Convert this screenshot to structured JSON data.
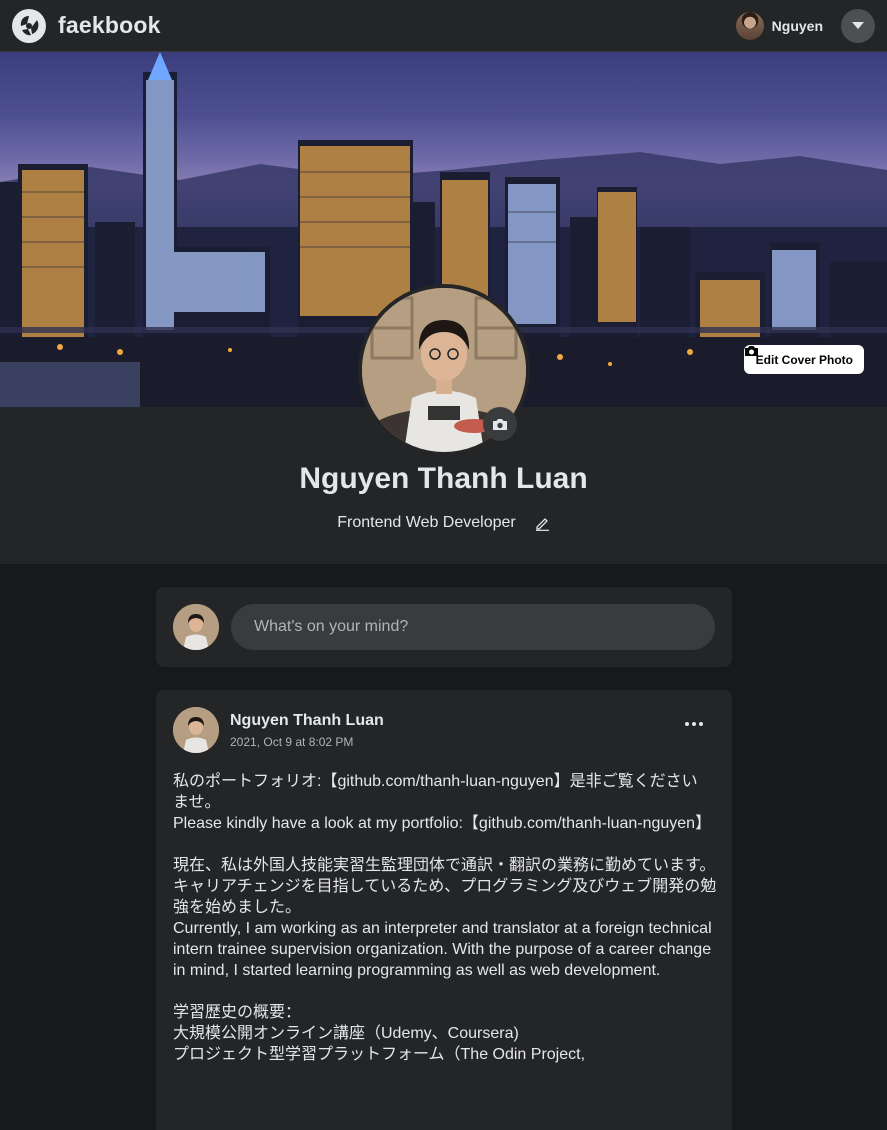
{
  "nav": {
    "brand": "faekbook",
    "user_name": "Nguyen"
  },
  "profile": {
    "name": "Nguyen Thanh Luan",
    "bio": "Frontend Web Developer",
    "edit_cover_label": "Edit Cover Photo"
  },
  "composer": {
    "placeholder": "What's on your mind?"
  },
  "post": {
    "author": "Nguyen Thanh Luan",
    "timestamp": "2021, Oct 9 at 8:02 PM",
    "paragraphs": [
      "私のポートフォリオ:【github.com/thanh-luan-nguyen】是非ご覧ください ませ。\nPlease kindly have a look at my portfolio:【github.com/thanh-luan-nguyen】",
      "現在、私は外国人技能実習生監理団体で通訳・翻訳の業務に勤めています。キャリアチェンジを目指しているため、プログラミング及びウェブ開発の勉強を始めました。\nCurrently, I am working as an interpreter and translator at a foreign technical intern trainee supervision organization. With the purpose of a career change in mind, I started learning programming as well as web development.",
      "学習歴史の概要：\n大規模公開オンライン講座（Udemy、Coursera)\nプロジェクト型学習プラットフォーム（The Odin Project,"
    ]
  },
  "colors": {
    "page_bg": "#18191a",
    "surface": "#242526",
    "input_bg": "#3a3b3c",
    "text_primary": "#e4e6eb",
    "text_secondary": "#b0b3b8"
  }
}
